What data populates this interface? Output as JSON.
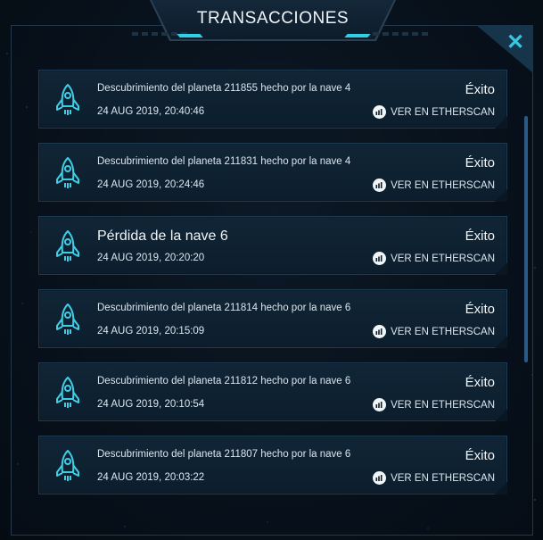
{
  "dialog": {
    "title": "TRANSACCIONES",
    "close_icon": "close-icon",
    "close_symbol": "✕"
  },
  "colors": {
    "accent": "#2fd0e6",
    "row_bg": "#102536",
    "row_border": "#1e3b52",
    "scrollbar": "#2a5a86"
  },
  "transactions": [
    {
      "icon": "rocket-icon",
      "description": "Descubrimiento del planeta 211855 hecho por la nave 4",
      "date": "24 AUG 2019, 20:40:46",
      "status": "Éxito",
      "link_label": "VER EN ETHERSCAN",
      "link_icon": "etherscan-icon"
    },
    {
      "icon": "rocket-icon",
      "description": "Descubrimiento del planeta 211831 hecho por la nave 4",
      "date": "24 AUG 2019, 20:24:46",
      "status": "Éxito",
      "link_label": "VER EN ETHERSCAN",
      "link_icon": "etherscan-icon"
    },
    {
      "icon": "rocket-icon",
      "description": "Pérdida de la nave 6",
      "date": "24 AUG 2019, 20:20:20",
      "status": "Éxito",
      "link_label": "VER EN ETHERSCAN",
      "link_icon": "etherscan-icon"
    },
    {
      "icon": "rocket-icon",
      "description": "Descubrimiento del planeta 211814 hecho por la nave 6",
      "date": "24 AUG 2019, 20:15:09",
      "status": "Éxito",
      "link_label": "VER EN ETHERSCAN",
      "link_icon": "etherscan-icon"
    },
    {
      "icon": "rocket-icon",
      "description": "Descubrimiento del planeta 211812 hecho por la nave 6",
      "date": "24 AUG 2019, 20:10:54",
      "status": "Éxito",
      "link_label": "VER EN ETHERSCAN",
      "link_icon": "etherscan-icon"
    },
    {
      "icon": "rocket-icon",
      "description": "Descubrimiento del planeta 211807 hecho por la nave 6",
      "date": "24 AUG 2019, 20:03:22",
      "status": "Éxito",
      "link_label": "VER EN ETHERSCAN",
      "link_icon": "etherscan-icon"
    }
  ]
}
